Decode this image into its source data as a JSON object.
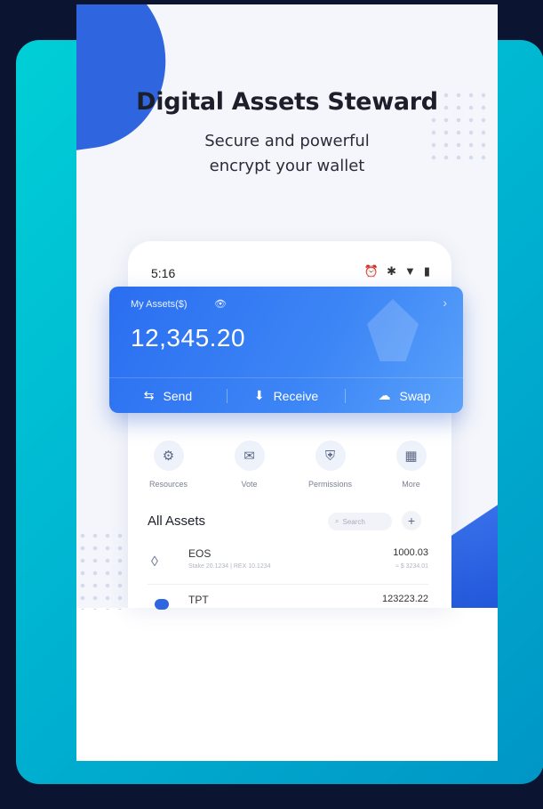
{
  "hero": {
    "title": "Digital Assets Steward",
    "subtitle_line1": "Secure and powerful",
    "subtitle_line2": "encrypt your wallet"
  },
  "status_bar": {
    "time": "5:16",
    "icons": [
      "alarm-icon",
      "bluetooth-icon",
      "wifi-icon",
      "battery-icon"
    ]
  },
  "asset_card": {
    "label": "My Assets($)",
    "amount": "12,345.20",
    "actions": [
      {
        "label": "Send",
        "icon": "send-icon"
      },
      {
        "label": "Receive",
        "icon": "download-icon"
      },
      {
        "label": "Swap",
        "icon": "swap-icon"
      }
    ]
  },
  "quick_actions": [
    {
      "label": "Resources",
      "icon": "resources-icon"
    },
    {
      "label": "Vote",
      "icon": "vote-icon"
    },
    {
      "label": "Permissions",
      "icon": "shield-icon"
    },
    {
      "label": "More",
      "icon": "grid-icon"
    }
  ],
  "assets_section": {
    "title": "All Assets",
    "search_placeholder": "Search"
  },
  "tokens": [
    {
      "name": "EOS",
      "sub": "Stake 20.1234  |  REX 10.1234",
      "balance": "1000.03",
      "fiat": "≈ $ 3234.01"
    },
    {
      "name": "TPT",
      "sub": "",
      "balance": "123223.22",
      "fiat": ""
    }
  ],
  "colors": {
    "accent_blue": "#2f66e0",
    "card_gradient_start": "#00cfd6",
    "card_gradient_end": "#0096c6",
    "background": "#0b1430"
  }
}
